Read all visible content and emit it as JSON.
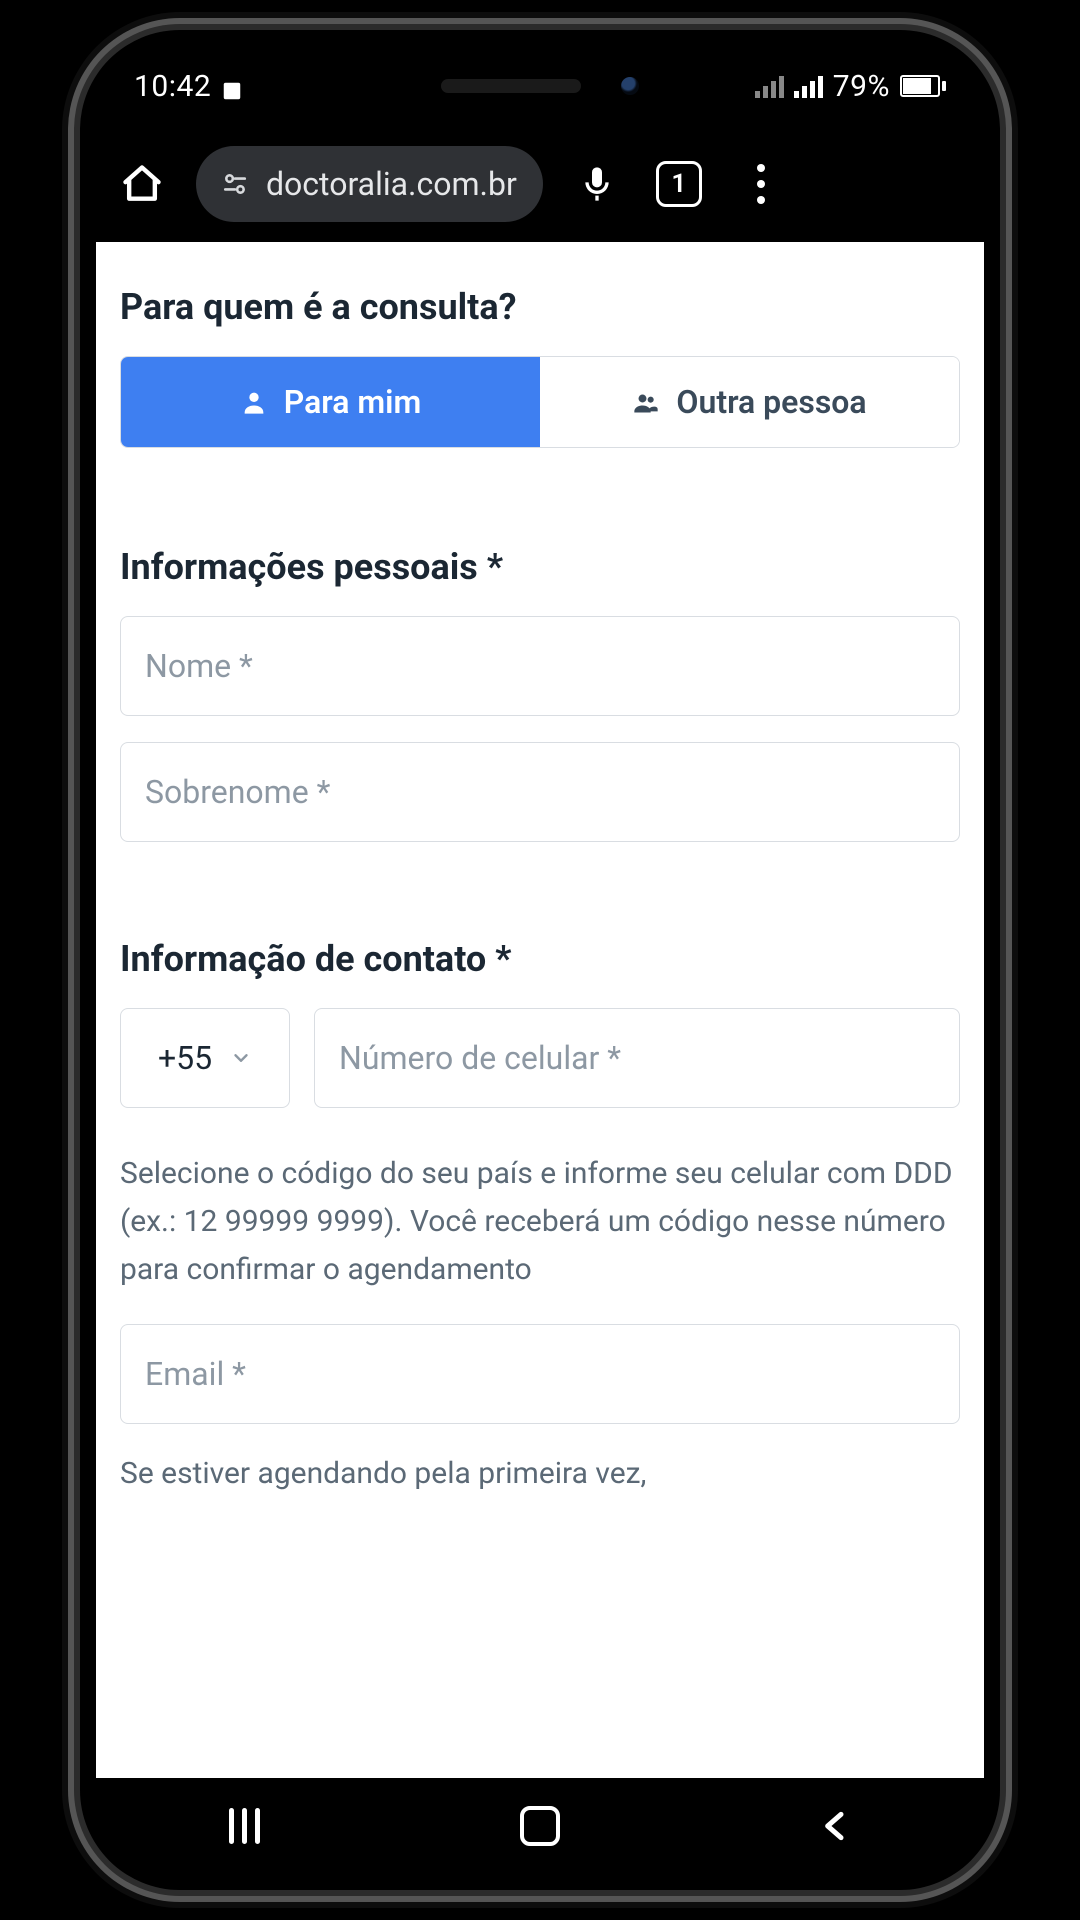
{
  "statusbar": {
    "time": "10:42",
    "battery_pct": "79%"
  },
  "browser": {
    "url": "doctoralia.com.br",
    "tab_count": "1"
  },
  "form": {
    "who_title": "Para quem é a consulta?",
    "seg_me": "Para mim",
    "seg_other": "Outra pessoa",
    "personal_title": "Informações pessoais *",
    "first_name_ph": "Nome *",
    "last_name_ph": "Sobrenome *",
    "contact_title": "Informação de contato *",
    "country_code": "+55",
    "phone_ph": "Número de celular *",
    "phone_help": "Selecione o código do seu país e informe seu celular com DDD (ex.: 12 99999 9999). Você receberá um código nesse número para confirmar o agendamento",
    "email_ph": "Email *",
    "email_help": "Se estiver agendando pela primeira vez,"
  }
}
